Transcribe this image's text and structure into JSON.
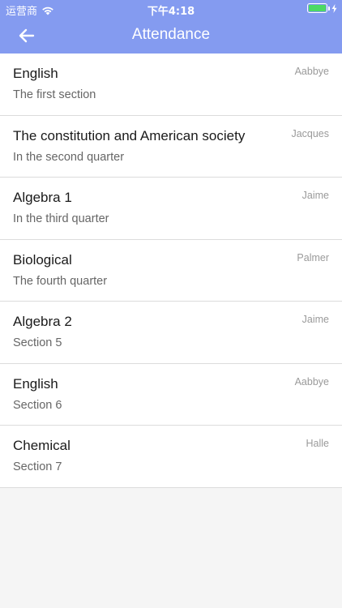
{
  "status_bar": {
    "carrier": "运营商",
    "time": "下午4:18",
    "battery_level": 1.0,
    "battery_color": "#4cd964"
  },
  "nav": {
    "title": "Attendance",
    "back_icon": "arrow-left-icon",
    "background_color": "#849bf0"
  },
  "items": [
    {
      "title": "English",
      "subtitle": "The first section",
      "teacher": "Aabbye"
    },
    {
      "title": "The constitution and American society",
      "subtitle": "In the second quarter",
      "teacher": "Jacques"
    },
    {
      "title": "Algebra 1",
      "subtitle": "In the third quarter",
      "teacher": "Jaime"
    },
    {
      "title": "Biological",
      "subtitle": "The fourth quarter",
      "teacher": "Palmer"
    },
    {
      "title": "Algebra 2",
      "subtitle": "Section 5",
      "teacher": "Jaime"
    },
    {
      "title": "English",
      "subtitle": "Section 6",
      "teacher": "Aabbye"
    },
    {
      "title": "Chemical",
      "subtitle": "Section 7",
      "teacher": "Halle"
    }
  ]
}
